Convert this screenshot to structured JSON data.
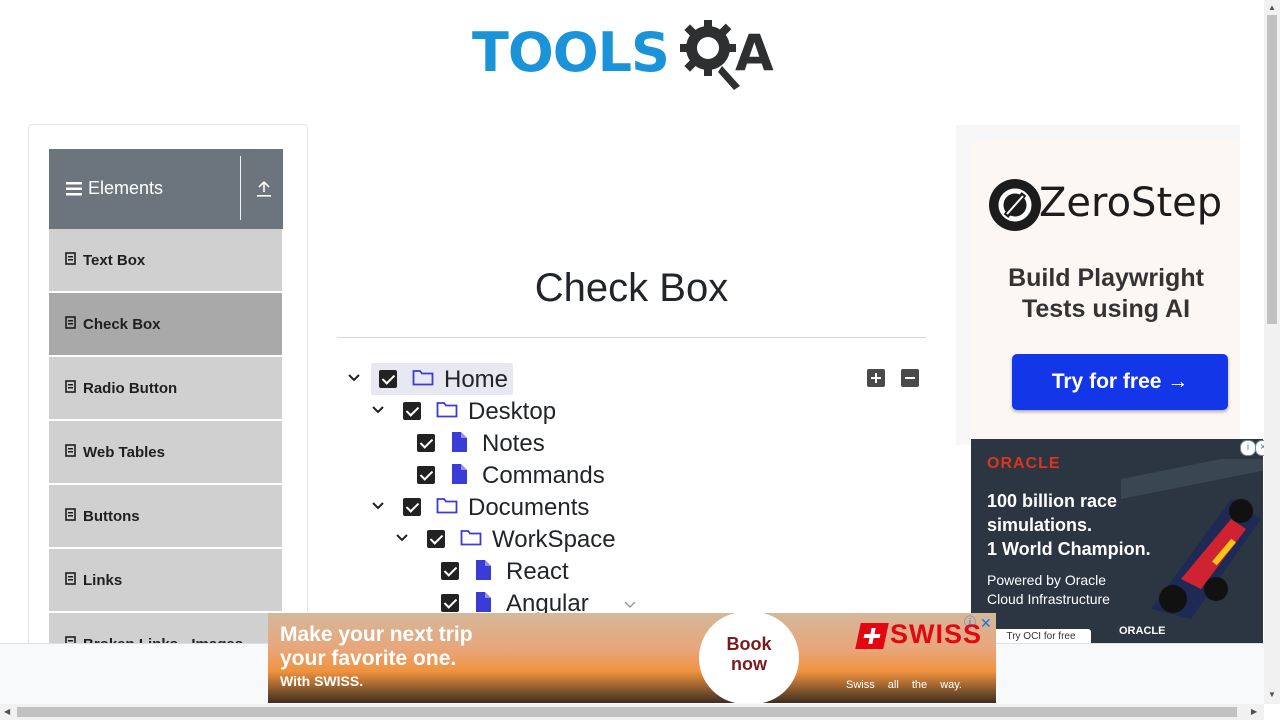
{
  "logo": {
    "text_left": "TOOLS",
    "text_right": "A"
  },
  "sidebar": {
    "group_title": "Elements",
    "items": [
      {
        "label": "Text Box",
        "active": false
      },
      {
        "label": "Check Box",
        "active": true
      },
      {
        "label": "Radio Button",
        "active": false
      },
      {
        "label": "Web Tables",
        "active": false
      },
      {
        "label": "Buttons",
        "active": false
      },
      {
        "label": "Links",
        "active": false
      },
      {
        "label": "Broken Links - Images",
        "active": false
      }
    ]
  },
  "main": {
    "title": "Check Box",
    "tree": [
      {
        "label": "Home",
        "type": "folder",
        "expanded": true,
        "checked": true
      },
      {
        "label": "Desktop",
        "type": "folder",
        "expanded": true,
        "checked": true
      },
      {
        "label": "Notes",
        "type": "file",
        "checked": true
      },
      {
        "label": "Commands",
        "type": "file",
        "checked": true
      },
      {
        "label": "Documents",
        "type": "folder",
        "expanded": true,
        "checked": true
      },
      {
        "label": "WorkSpace",
        "type": "folder",
        "expanded": true,
        "checked": true
      },
      {
        "label": "React",
        "type": "file",
        "checked": true
      },
      {
        "label": "Angular",
        "type": "file",
        "checked": true
      }
    ],
    "expand_all_label": "+",
    "collapse_all_label": "−"
  },
  "ads": {
    "zerostep": {
      "brand": "ZeroStep",
      "headline": "Build Playwright Tests using AI",
      "cta": "Try for free →"
    },
    "oracle": {
      "brand": "ORACLE",
      "headline_line1": "100 billion race",
      "headline_line2": "simulations.",
      "headline_line3": "1 World Champion.",
      "sub_line1": "Powered by Oracle",
      "sub_line2": "Cloud Infrastructure",
      "button": "Try OCI for free",
      "footer_logo": "ORACLE"
    },
    "swiss": {
      "headline_line1": "Make your next trip",
      "headline_line2": "your favorite one.",
      "small": "With SWISS.",
      "cta_line1": "Book",
      "cta_line2": "now",
      "brand": "SWISS",
      "tagline": "Swiss all the way."
    }
  },
  "colors": {
    "logo_blue": "#1a93d9",
    "sidebar_header": "#6c757d",
    "sidebar_item": "#d0d0d0",
    "sidebar_item_active": "#a9a9a9",
    "tree_icon": "#3b3bd6",
    "zerostep_button": "#1337e8",
    "oracle_red": "#e0331f",
    "swiss_red": "#e30613"
  }
}
